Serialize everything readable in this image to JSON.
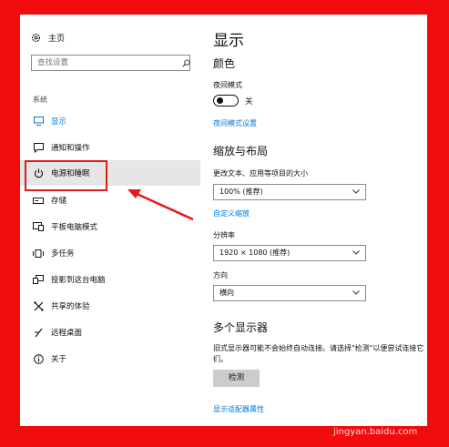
{
  "sidebar": {
    "home_label": "主页",
    "search_placeholder": "查找设置",
    "section_label": "系统",
    "items": [
      {
        "label": "显示",
        "icon": "monitor-icon"
      },
      {
        "label": "通知和操作",
        "icon": "notification-icon"
      },
      {
        "label": "电源和睡眠",
        "icon": "power-icon"
      },
      {
        "label": "存储",
        "icon": "storage-icon"
      },
      {
        "label": "平板电脑模式",
        "icon": "tablet-mode-icon"
      },
      {
        "label": "多任务",
        "icon": "multitask-icon"
      },
      {
        "label": "投影到这台电脑",
        "icon": "project-icon"
      },
      {
        "label": "共享的体验",
        "icon": "shared-experience-icon"
      },
      {
        "label": "远程桌面",
        "icon": "remote-desktop-icon"
      },
      {
        "label": "关于",
        "icon": "info-icon"
      }
    ]
  },
  "main": {
    "title": "显示",
    "color_heading": "颜色",
    "night_mode_label": "夜间模式",
    "night_mode_state": "关",
    "night_mode_settings_link": "夜间模式设置",
    "scale_heading": "缩放与布局",
    "text_size_label": "更改文本、应用等项目的大小",
    "text_size_value": "100% (推荐)",
    "custom_scale_link": "自定义缩放",
    "resolution_label": "分辨率",
    "resolution_value": "1920 × 1080 (推荐)",
    "orientation_label": "方向",
    "orientation_value": "横向",
    "multi_display_heading": "多个显示器",
    "multi_display_text": "旧式显示器可能不会始终自动连接。请选择\"检测\"以便尝试连接它们。",
    "detect_button": "检测",
    "adapter_link": "显示适配器属性"
  },
  "watermark": "jingyan.baidu.com",
  "colors": {
    "accent": "#0078d7",
    "border": "#f00c0c",
    "annotation": "#e11a1a"
  }
}
